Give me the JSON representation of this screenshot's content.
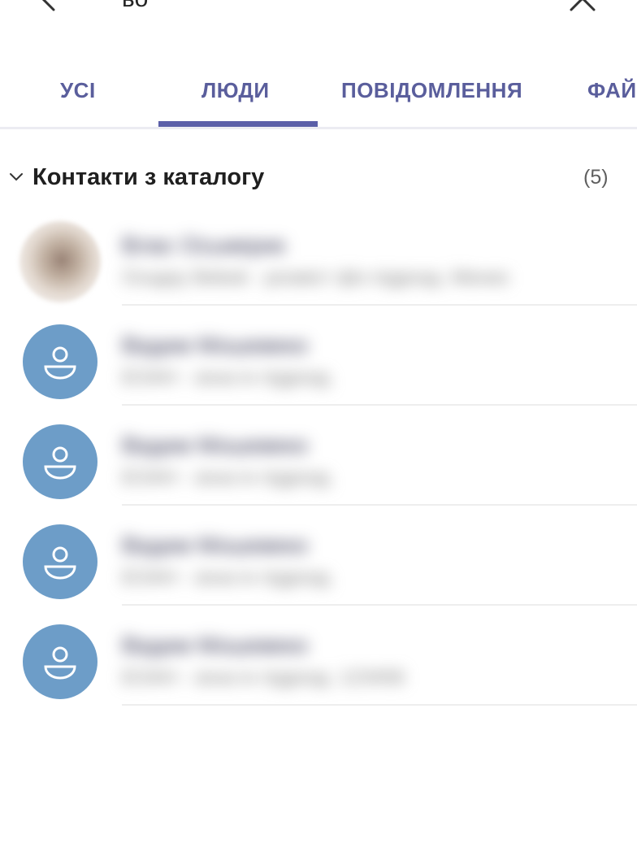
{
  "search": {
    "query": "ьо"
  },
  "tabs": [
    {
      "label": "УСІ",
      "active": false
    },
    {
      "label": "ЛЮДИ",
      "active": true
    },
    {
      "label": "ПОВІДОМЛЕННЯ",
      "active": false
    },
    {
      "label": "ФАЙ",
      "active": false
    }
  ],
  "section": {
    "title": "Контакти з каталогу",
    "count": "(5)"
  },
  "contacts": [
    {
      "name": "Влас Осьмерик",
      "detail": "Осадку Bebok - розміст фіз підрозд. Менко",
      "avatar": "photo"
    },
    {
      "name": "Вадим Мошевеко",
      "detail": "ЕОАН - зона ін підрозд.",
      "avatar": "person-icon"
    },
    {
      "name": "Вадим Мошевеко",
      "detail": "ЕОАН - зона ін підрозд.",
      "avatar": "person-icon"
    },
    {
      "name": "Вадим Мошевеко",
      "detail": "ЕОАН - зона ін підрозд.",
      "avatar": "person-icon"
    },
    {
      "name": "Вадим Мошевеко",
      "detail": "ЕОАН - зона ін підрозд. 123456",
      "avatar": "person-icon"
    }
  ],
  "colors": {
    "accent": "#5b5fa8",
    "tab_text": "#5a5e9c",
    "avatar_bg": "#6d9dc8"
  }
}
